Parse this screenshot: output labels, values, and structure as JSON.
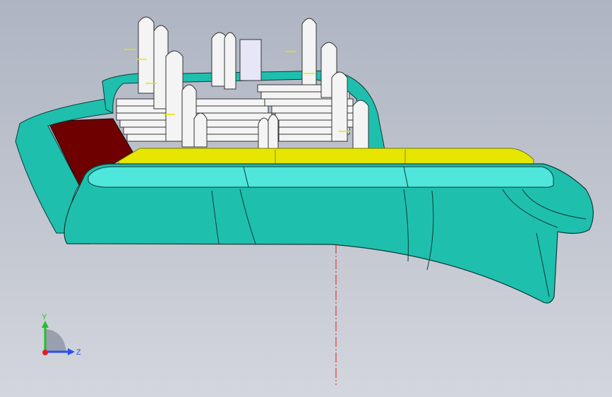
{
  "viewport": {
    "colors": {
      "part_teal": "#1fbfae",
      "part_teal_light": "#4fe6db",
      "part_edge": "#0b3a36",
      "insert_yellow": "#e6e600",
      "insert_yellow_dark": "#9b9b00",
      "cavity_red": "#6e0000",
      "ribs_white": "#f4f4f4",
      "ribs_lavender": "#e6e6f7",
      "centerline_red": "#d81f1f"
    }
  },
  "triad": {
    "y_label": "Y",
    "z_label": "Z",
    "colors": {
      "y": "#22c02a",
      "z": "#2a4ff0",
      "x": "#e02020",
      "plane": "#8f97a6"
    }
  }
}
